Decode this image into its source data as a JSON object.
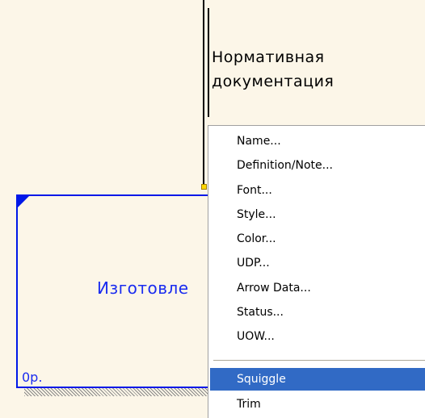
{
  "arrow": {
    "label_line1": "Нормативная",
    "label_line2": "документация"
  },
  "activity": {
    "name": "Изготовле",
    "cost": "0р."
  },
  "context_menu": {
    "items": [
      {
        "label": "Name..."
      },
      {
        "label": "Definition/Note..."
      },
      {
        "label": "Font..."
      },
      {
        "label": "Style..."
      },
      {
        "label": "Color..."
      },
      {
        "label": "UDP..."
      },
      {
        "label": "Arrow Data..."
      },
      {
        "label": "Status..."
      },
      {
        "label": "UOW..."
      }
    ],
    "items_after_separator": [
      {
        "label": "Squiggle",
        "selected": true
      },
      {
        "label": "Trim"
      }
    ]
  },
  "colors": {
    "canvas_bg": "#fcf6e8",
    "activity_border": "#0018e8",
    "activity_text": "#1a2cf0",
    "menu_highlight": "#316ac5"
  }
}
